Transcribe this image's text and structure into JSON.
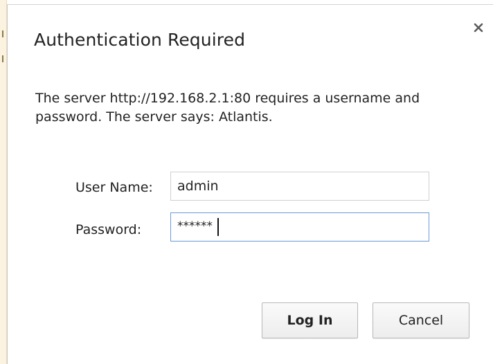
{
  "dialog": {
    "title": "Authentication Required",
    "close_icon": "close-icon",
    "message": "The server http://192.168.2.1:80 requires a username and password. The server says: Atlantis."
  },
  "form": {
    "username_label": "User Name:",
    "username_value": "admin",
    "password_label": "Password:",
    "password_value": "******"
  },
  "buttons": {
    "login_label": "Log In",
    "cancel_label": "Cancel"
  },
  "colors": {
    "focus_border": "#6a9ad8",
    "text": "#222222",
    "background": "#ffffff"
  }
}
